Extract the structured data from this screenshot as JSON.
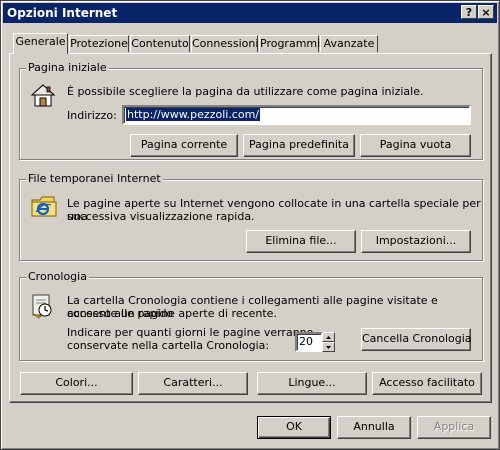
{
  "window": {
    "title": "Opzioni Internet",
    "help_label": "?",
    "close_label": "×"
  },
  "tabs": [
    {
      "label": "Generale"
    },
    {
      "label": "Protezione"
    },
    {
      "label": "Contenuto"
    },
    {
      "label": "Connessioni"
    },
    {
      "label": "Programmi"
    },
    {
      "label": "Avanzate"
    }
  ],
  "home": {
    "title": "Pagina iniziale",
    "description": "È possibile scegliere la pagina da utilizzare come pagina iniziale.",
    "address_label": "Indirizzo:",
    "address_value": "http://www.pezzoli.com/",
    "current_button": "Pagina corrente",
    "default_button": "Pagina predefinita",
    "blank_button": "Pagina vuota",
    "icon": "home-icon"
  },
  "temp": {
    "title": "File temporanei Internet",
    "description_line1": "Le pagine aperte su Internet vengono collocate in una cartella speciale per una",
    "description_line2": "successiva visualizzazione rapida.",
    "delete_button": "Elimina file...",
    "settings_button": "Impostazioni...",
    "icon": "ie-folder-icon"
  },
  "history": {
    "title": "Cronologia",
    "description_line1": "La cartella Cronologia contiene i collegamenti alle pagine visitate e consente un rapido",
    "description_line2": "accesso alle pagine aperte di recente.",
    "days_label_line1": "Indicare per quanti giorni le pagine verranno",
    "days_label_line2": "conservate nella cartella Cronologia:",
    "days_value": "20",
    "clear_button": "Cancella Cronologia",
    "icon": "history-icon"
  },
  "bottom": {
    "colors_button": "Colori...",
    "fonts_button": "Caratteri...",
    "languages_button": "Lingue...",
    "accessibility_button": "Accesso facilitato"
  },
  "dialog": {
    "ok_button": "OK",
    "cancel_button": "Annulla",
    "apply_button": "Applica"
  }
}
